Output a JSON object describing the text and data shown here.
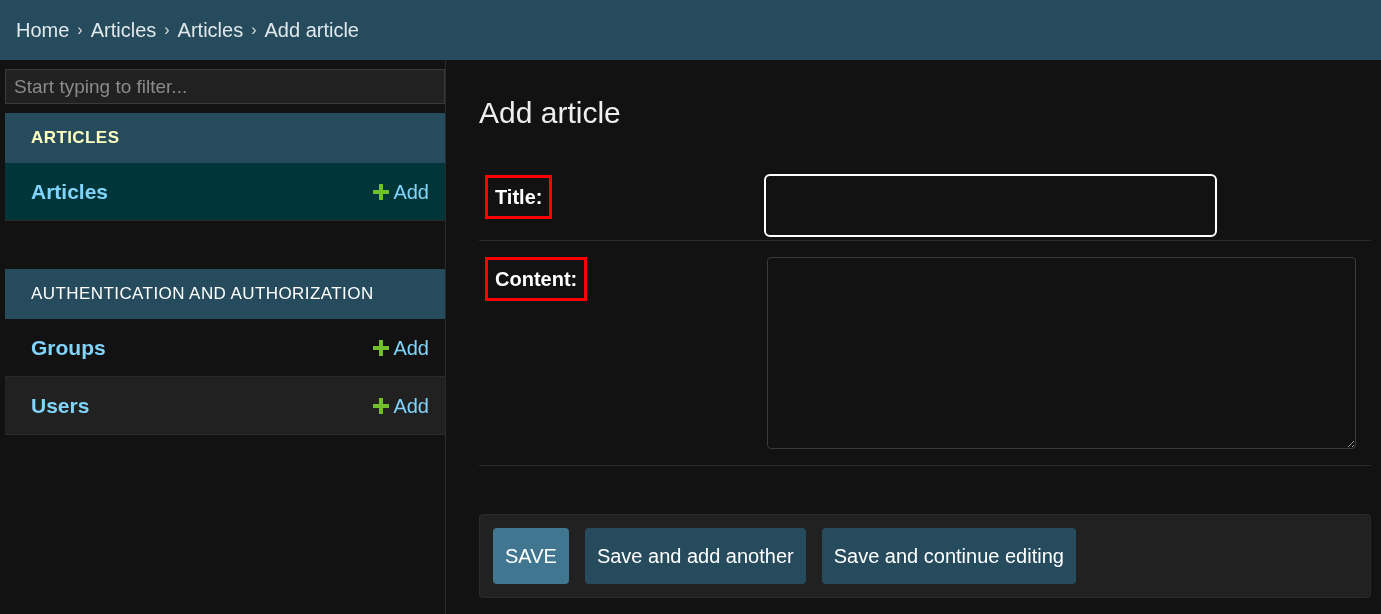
{
  "breadcrumbs": [
    "Home",
    "Articles",
    "Articles",
    "Add article"
  ],
  "breadcrumb_separator": "›",
  "sidebar": {
    "filter": {
      "placeholder": "Start typing to filter..."
    },
    "modules": [
      {
        "title": "ARTICLES",
        "current": true,
        "items": [
          {
            "label": "Articles",
            "add": "Add",
            "selected": true
          }
        ]
      },
      {
        "title": "AUTHENTICATION AND AUTHORIZATION",
        "current": false,
        "items": [
          {
            "label": "Groups",
            "add": "Add",
            "selected": false
          },
          {
            "label": "Users",
            "add": "Add",
            "selected": false
          }
        ]
      }
    ]
  },
  "page_title": "Add article",
  "fields": [
    {
      "label": "Title:",
      "kind": "text",
      "focused": true,
      "highlighted": true
    },
    {
      "label": "Content:",
      "kind": "textarea",
      "focused": false,
      "highlighted": true
    }
  ],
  "buttons": [
    {
      "label": "SAVE",
      "kind": "primary"
    },
    {
      "label": "Save and add another",
      "kind": "secondary"
    },
    {
      "label": "Save and continue editing",
      "kind": "secondary"
    }
  ]
}
